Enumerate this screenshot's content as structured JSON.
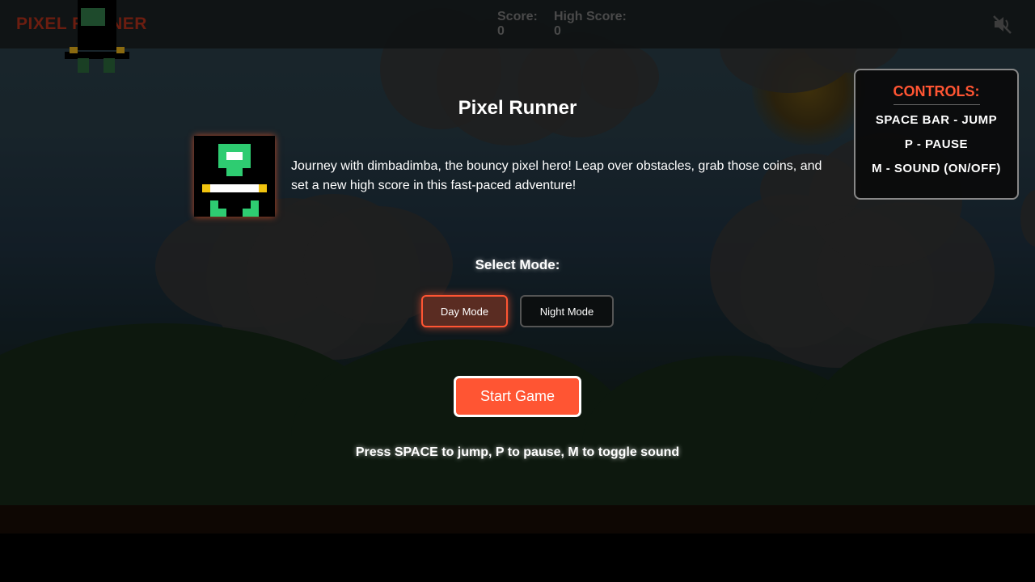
{
  "hud": {
    "title": "PIXEL RUNNER",
    "score_label": "Score:",
    "score_value": "0",
    "high_score_label": "High Score:",
    "high_score_value": "0",
    "sound_icon": "sound-muted-icon"
  },
  "modal": {
    "title": "Pixel Runner",
    "description": "Journey with dimbadimba, the bouncy pixel hero! Leap over obstacles, grab those coins, and set a new high score in this fast-paced adventure!",
    "select_mode_label": "Select Mode:",
    "modes": [
      {
        "label": "Day Mode",
        "selected": true
      },
      {
        "label": "Night Mode",
        "selected": false
      }
    ],
    "start_label": "Start Game",
    "hint": "Press SPACE to jump, P to pause, M to toggle sound"
  },
  "controls": {
    "title": "CONTROLS:",
    "items": [
      "SPACE BAR - JUMP",
      "P - PAUSE",
      "M - SOUND (ON/OFF)"
    ]
  },
  "colors": {
    "accent": "#ff5533",
    "hero_green": "#2ecc71",
    "hero_yellow": "#f1c40f"
  }
}
